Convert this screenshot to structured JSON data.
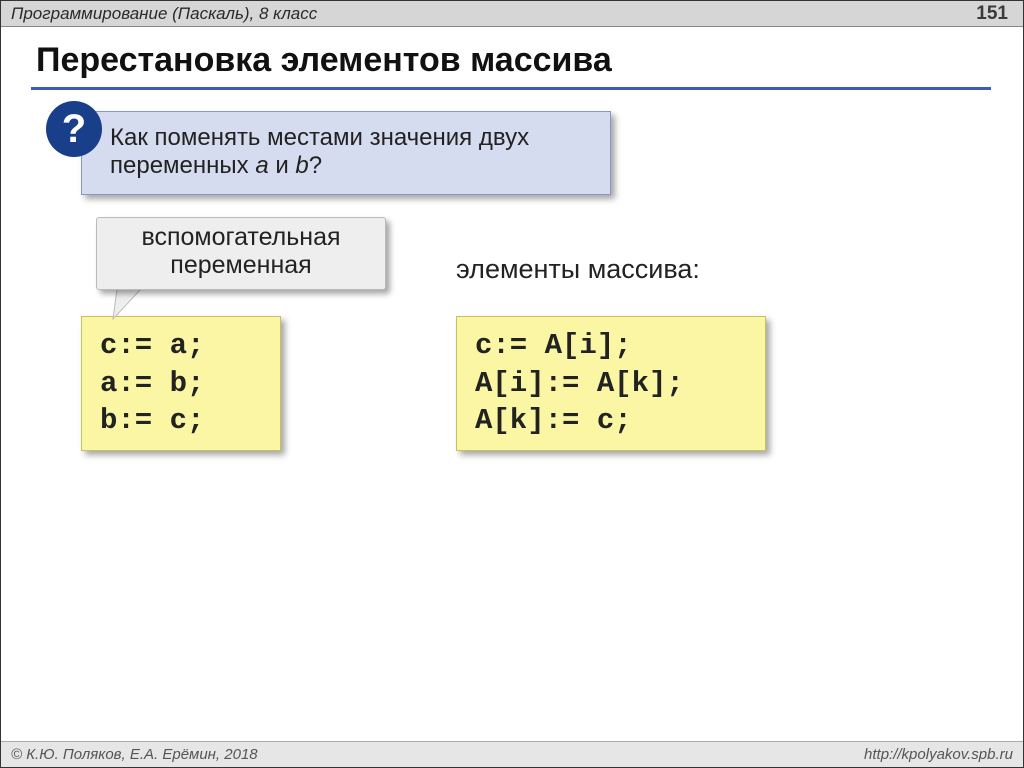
{
  "header": {
    "title": "Программирование (Паскаль), 8 класс",
    "page": "151"
  },
  "title": "Перестановка элементов массива",
  "question": {
    "mark": "?",
    "line1": "Как поменять местами значения двух",
    "line2_prefix": "переменных ",
    "var_a": "a",
    "line2_middle": " и ",
    "var_b": "b",
    "line2_suffix": "?"
  },
  "callout": {
    "line1": "вспомогательная",
    "line2": "переменная"
  },
  "array_label": "элементы массива:",
  "code_left": "c:= a;\na:= b;\nb:= c;",
  "code_right": "c:= A[i];\nA[i]:= A[k];\nA[k]:= c;",
  "footer": {
    "copyright": "© К.Ю. Поляков, Е.А. Ерёмин, 2018",
    "url": "http://kpolyakov.spb.ru"
  }
}
